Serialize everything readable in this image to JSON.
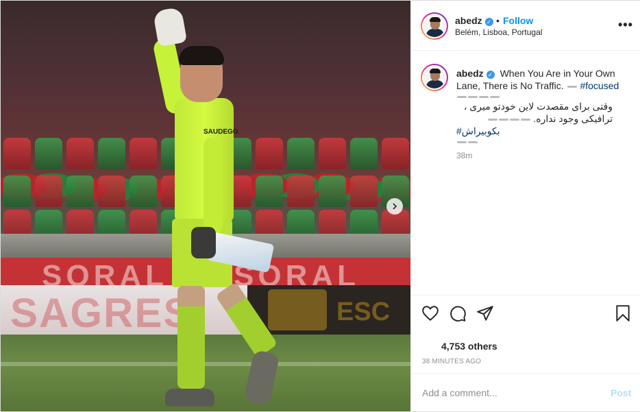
{
  "post": {
    "username": "abedz",
    "verified": true,
    "separator": "•",
    "follow_label": "Follow",
    "location": "Belém, Lisboa, Portugal",
    "more_label": "•••"
  },
  "media": {
    "board_texts": [
      "SAGRES",
      "ESC"
    ],
    "sponsor": "SAUDEGO",
    "carousel_next": "next-arrow"
  },
  "caption": {
    "username": "abedz",
    "text_en": "When You Are in Your Own Lane, There is No Traffic.",
    "hashtag_en": "#focused",
    "text_fa_1": "وقتی برای مقصدت لاین خودتو میری ،",
    "text_fa_2": "ترافیکی وجود نداره.",
    "hashtag_fa": "#بکوبیراش",
    "time_ago": "38m"
  },
  "actions": {
    "icons": [
      "heart-icon",
      "comment-icon",
      "share-icon",
      "bookmark-icon"
    ]
  },
  "likes": {
    "text": "4,753 others"
  },
  "timestamp": "38 MINUTES AGO",
  "comment": {
    "placeholder": "Add a comment...",
    "post_label": "Post"
  },
  "colors": {
    "accent": "#0095f6",
    "hashtag": "#00376b",
    "muted": "#8e8e8e",
    "post_disabled": "#b2dffc",
    "verified": "#3897f0"
  }
}
